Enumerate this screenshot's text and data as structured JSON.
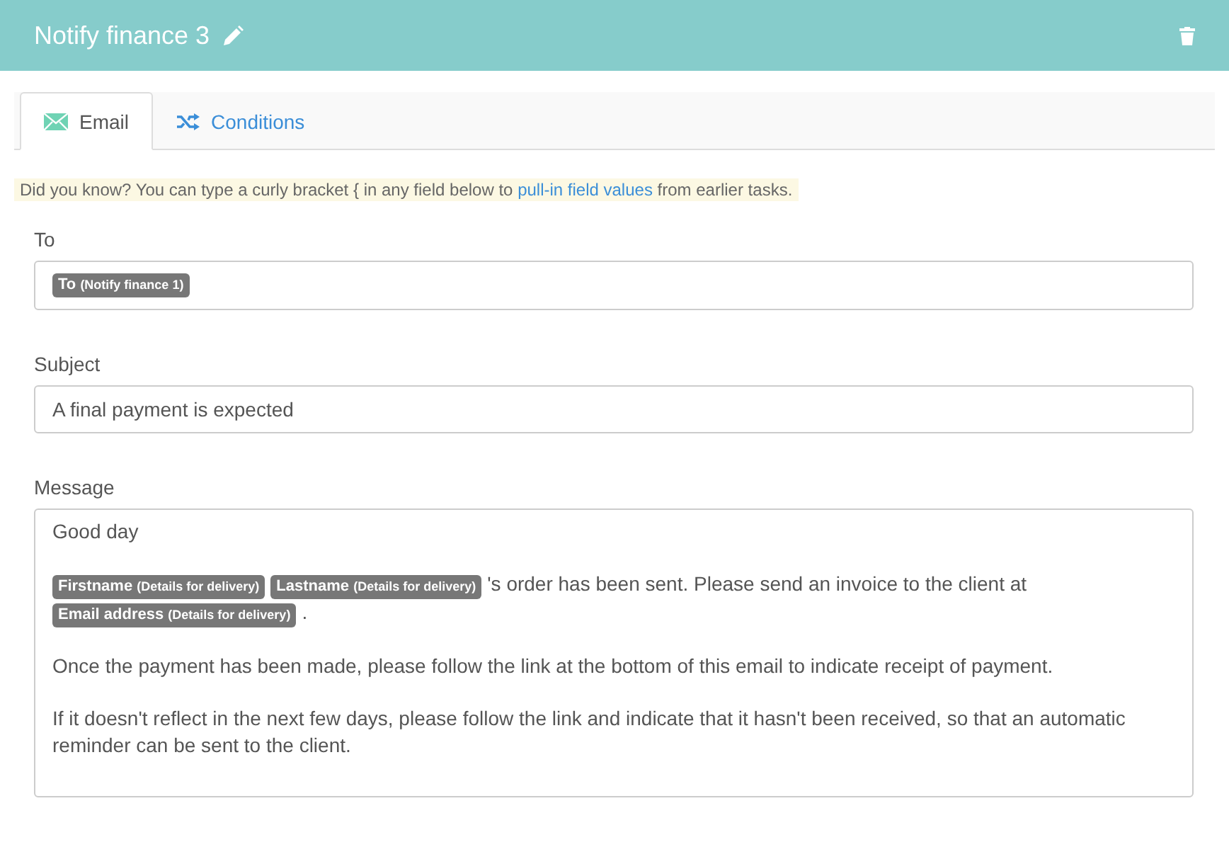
{
  "header": {
    "title": "Notify finance 3"
  },
  "tabs": [
    {
      "label": "Email",
      "kind": "envelope",
      "selected": true
    },
    {
      "label": "Conditions",
      "kind": "shuffle",
      "selected": false
    }
  ],
  "hint": {
    "before": "Did you know? You can type a curly bracket { in any field below to",
    "link": "pull-in field values",
    "after": "from earlier tasks."
  },
  "fields": [
    {
      "label": "To",
      "kind": "tokens",
      "tokens": [
        {
          "name": "To",
          "source": "(Notify finance 1)"
        }
      ]
    },
    {
      "label": "Subject",
      "kind": "text",
      "value": "A final payment is expected"
    },
    {
      "label": "Message",
      "kind": "message",
      "paragraphs": [
        [
          {
            "kind": "text",
            "text": "Good day"
          }
        ],
        [
          {
            "kind": "token",
            "name": "Firstname",
            "source": "(Details for delivery)"
          },
          {
            "kind": "token",
            "name": "Lastname",
            "source": "(Details for delivery)"
          },
          {
            "kind": "text",
            "text": "'s order has been sent. Please send an invoice to the client at"
          },
          {
            "kind": "token",
            "name": "Email address",
            "source": "(Details for delivery)"
          },
          {
            "kind": "text",
            "text": "."
          }
        ],
        [
          {
            "kind": "text",
            "text": "Once the payment has been made, please follow the link at the bottom of this email to indicate receipt of payment."
          }
        ],
        [
          {
            "kind": "text",
            "text": "If it doesn't reflect in the next few days, please follow the link and indicate that it hasn't been received, so that an automatic reminder can be sent to the client."
          }
        ]
      ]
    }
  ]
}
